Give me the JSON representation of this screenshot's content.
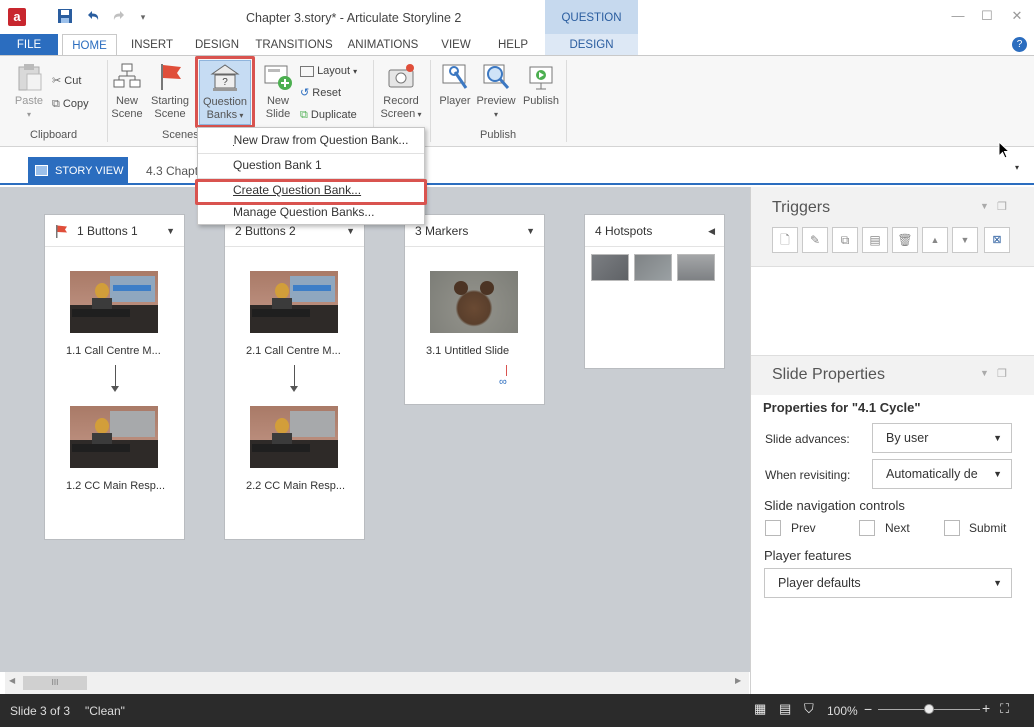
{
  "window": {
    "title": "Chapter 3.story* - Articulate Storyline 2",
    "contextual_header": "QUESTION TOOLS",
    "app_icon_letter": "a"
  },
  "tabs": {
    "file": "FILE",
    "home": "HOME",
    "insert": "INSERT",
    "design": "DESIGN",
    "transitions": "TRANSITIONS",
    "animations": "ANIMATIONS",
    "view": "VIEW",
    "help": "HELP",
    "question_design": "DESIGN"
  },
  "ribbon": {
    "clipboard": {
      "paste": "Paste",
      "cut": "Cut",
      "copy": "Copy",
      "label": "Clipboard"
    },
    "scenes": {
      "new_scene_1": "New",
      "new_scene_2": "Scene",
      "starting_1": "Starting",
      "starting_2": "Scene",
      "qb_1": "Question",
      "qb_2": "Banks",
      "label": "Scenes"
    },
    "slides": {
      "new_slide_1": "New",
      "new_slide_2": "Slide",
      "layout": "Layout",
      "reset": "Reset",
      "duplicate": "Duplicate"
    },
    "record": {
      "line1": "Record",
      "line2": "Screen"
    },
    "publish": {
      "player": "Player",
      "preview": "Preview",
      "publish": "Publish",
      "label": "Publish"
    }
  },
  "question_bank_menu": {
    "new_draw": "New Draw from Question Bank...",
    "bank1": "Question Bank 1",
    "create": "Create Question Bank...",
    "manage": "Manage Question Banks..."
  },
  "story_tabs": {
    "story_view": "STORY VIEW",
    "chapter": "4.3 Chapt"
  },
  "scenes": [
    {
      "title": "1 Buttons 1",
      "slides": [
        "1.1 Call Centre M...",
        "1.2 CC Main Resp..."
      ]
    },
    {
      "title": "2 Buttons 2",
      "slides": [
        "2.1 Call Centre M...",
        "2.2 CC Main Resp..."
      ]
    },
    {
      "title": "3 Markers",
      "slides": [
        "3.1 Untitled Slide"
      ]
    },
    {
      "title": "4 Hotspots",
      "slides": []
    }
  ],
  "triggers_panel": {
    "title": "Triggers"
  },
  "slide_properties": {
    "title": "Slide Properties",
    "properties_for": "Properties for \"4.1 Cycle\"",
    "slide_advances_label": "Slide advances:",
    "slide_advances_value": "By user",
    "when_revisiting_label": "When revisiting:",
    "when_revisiting_value": "Automatically de",
    "nav_controls_title": "Slide navigation controls",
    "prev": "Prev",
    "next": "Next",
    "submit": "Submit",
    "player_features_title": "Player features",
    "player_features_value": "Player defaults"
  },
  "status": {
    "slide": "Slide 3 of 3",
    "state": "\"Clean\"",
    "zoom": "100%"
  },
  "colors": {
    "accent": "#2b6dbf",
    "highlight": "#d9534f",
    "canvas": "#c9cdd2",
    "status_bar": "#2b2b2b"
  }
}
